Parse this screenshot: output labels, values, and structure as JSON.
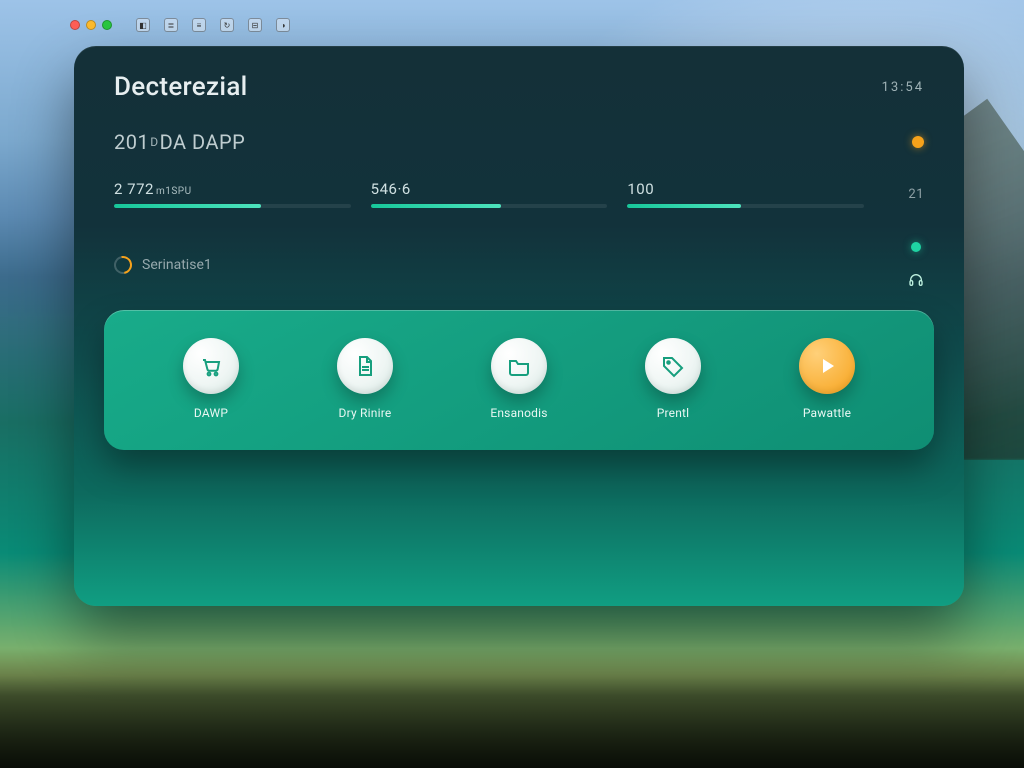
{
  "menubar": {
    "icons": [
      "◧",
      "≣",
      "≡",
      "↻",
      "⊟",
      "◑"
    ]
  },
  "header": {
    "title": "Decterezial",
    "clock": "13:54"
  },
  "subheader": {
    "line_pre": "201",
    "line_small": "D",
    "line_post": "DA DAPP"
  },
  "stats": [
    {
      "value": "2 772",
      "unit": "m1SPU",
      "progress": 62
    },
    {
      "value": "546·6",
      "unit": "",
      "progress": 55
    },
    {
      "value": "100",
      "unit": "",
      "progress": 48
    },
    {
      "value": "21",
      "unit": "",
      "progress": 0
    }
  ],
  "section": {
    "label": "Serinatise1"
  },
  "actions": [
    {
      "key": "dawp",
      "label": "DAWP",
      "icon": "cart"
    },
    {
      "key": "dry",
      "label": "Dry Rinire",
      "icon": "doc"
    },
    {
      "key": "ensamble",
      "label": "Ensanodis",
      "icon": "folder"
    },
    {
      "key": "prent",
      "label": "Prentl",
      "icon": "tag"
    },
    {
      "key": "pawatte",
      "label": "Pawattle",
      "icon": "play",
      "accent": true
    }
  ]
}
